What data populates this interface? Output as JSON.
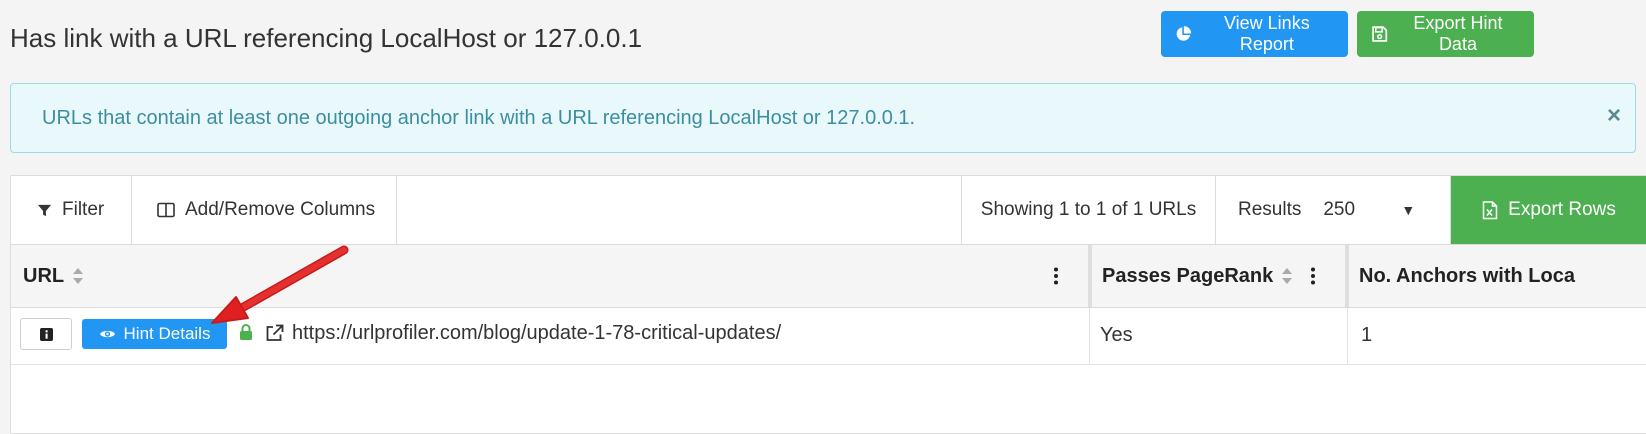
{
  "header": {
    "title": "Has link with a URL referencing LocalHost or 127.0.0.1",
    "view_links_label": "View Links Report",
    "export_hint_label": "Export Hint Data"
  },
  "alert": {
    "text": "URLs that contain at least one outgoing anchor link with a URL referencing LocalHost or 127.0.0.1.",
    "close_glyph": "×"
  },
  "toolbar": {
    "filter_label": "Filter",
    "columns_label": "Add/Remove Columns",
    "showing_text": "Showing 1 to 1 of 1 URLs",
    "results_label": "Results",
    "results_value": "250",
    "export_rows_label": "Export Rows"
  },
  "table": {
    "columns": [
      "URL",
      "Passes PageRank",
      "No. Anchors with Loca"
    ],
    "rows": [
      {
        "hint_label": "Hint Details",
        "url": "https://urlprofiler.com/blog/update-1-78-critical-updates/",
        "passes_pagerank": "Yes",
        "anchors": "1"
      }
    ]
  },
  "colors": {
    "primary": "#2196f3",
    "success": "#4caf50",
    "info_bg": "#e9f8fb",
    "info_text": "#3d8ea0",
    "annotation": "#e02020"
  },
  "icons": [
    "pie-chart-icon",
    "save-icon",
    "close-icon",
    "filter-icon",
    "columns-icon",
    "file-excel-icon",
    "sort-icon",
    "kebab-icon",
    "info-icon",
    "eye-icon",
    "lock-icon",
    "external-link-icon",
    "annotation-arrow"
  ]
}
